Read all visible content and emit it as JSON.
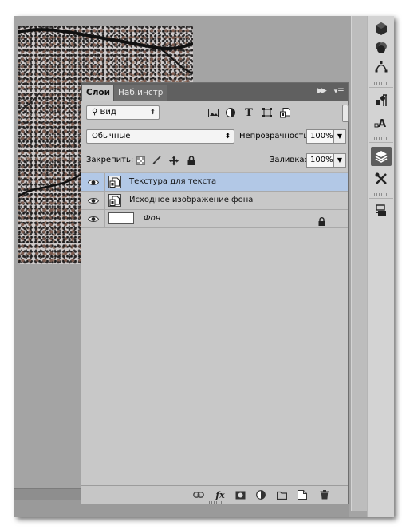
{
  "panel": {
    "tabs": [
      {
        "label": "Слои",
        "active": true
      },
      {
        "label": "Наб.инстр",
        "active": false
      }
    ],
    "collapse_icon": "double-chevron-right-icon",
    "menu_icon": "panel-menu-icon"
  },
  "filter": {
    "kind_label": "Вид",
    "kind_icon": "search-icon",
    "filter_icons": [
      "image-filter-icon",
      "adjustment-filter-icon",
      "type-filter-icon",
      "shape-filter-icon",
      "smart-object-filter-icon"
    ],
    "type_glyph": "T"
  },
  "blend": {
    "mode": "Обычные",
    "opacity_label": "Непрозрачность:",
    "opacity_value": "100%"
  },
  "lock": {
    "label": "Закрепить:",
    "lock_icons": [
      "lock-transparent-icon",
      "lock-brush-icon",
      "lock-move-icon",
      "lock-all-icon"
    ],
    "fill_label": "Заливка:",
    "fill_value": "100%"
  },
  "layers": [
    {
      "name": "Текстура для текста",
      "selected": true,
      "visible": true,
      "type": "smart-object"
    },
    {
      "name": "Исходное изображение фона",
      "selected": false,
      "visible": true,
      "type": "smart-object"
    },
    {
      "name": "Фон",
      "selected": false,
      "visible": true,
      "type": "background",
      "locked": true
    }
  ],
  "footer_icons": [
    "link-layers-icon",
    "fx-icon",
    "add-mask-icon",
    "adjustment-layer-icon",
    "new-group-icon",
    "new-layer-icon",
    "delete-layer-icon"
  ],
  "footer_fx": "fx",
  "tool_strip": [
    "3d-icon",
    "channels-icon",
    "paths-icon",
    "paragraph-icon",
    "character-icon",
    "layers-panel-icon",
    "tools-icon",
    "layer-comps-icon"
  ],
  "colors": {
    "selected_row": "#b2c8e6",
    "tab_bar": "#606060",
    "panel_bg": "#c8c8c8"
  }
}
